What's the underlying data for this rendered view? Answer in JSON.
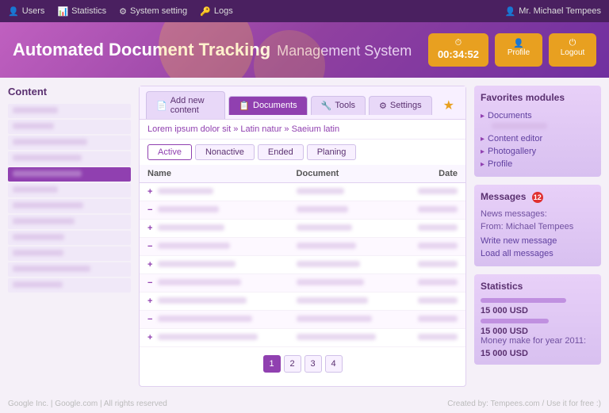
{
  "topnav": {
    "items": [
      {
        "label": "Users",
        "icon": "👤"
      },
      {
        "label": "Statistics",
        "icon": "📊"
      },
      {
        "label": "System setting",
        "icon": "⚙"
      },
      {
        "label": "Logs",
        "icon": "🔑"
      }
    ],
    "user": "Mr. Michael Tempees",
    "user_icon": "👤"
  },
  "header": {
    "title_main": "Automated Document Tracking",
    "title_sub": "Management System",
    "btn_time": "00:34:52",
    "btn_profile": "Profile",
    "btn_logout": "Logout"
  },
  "sidebar": {
    "title": "Content",
    "items": [
      {
        "label": "Lorem ipsum dolor sit",
        "active": false
      },
      {
        "label": "Lorem ipsum dolor sit",
        "active": false
      },
      {
        "label": "Lorem ipsum dolor sit",
        "active": false
      },
      {
        "label": "Lorem ipsum dolor sit",
        "active": false
      },
      {
        "label": "Content ipsum dolor sit",
        "active": true
      },
      {
        "label": "Lorem sit amet",
        "active": false
      },
      {
        "label": "Nec sit amet adipiscing",
        "active": false
      },
      {
        "label": "Nec sit amet adipiscing",
        "active": false
      },
      {
        "label": "Augue ipsum dolor amet",
        "active": false
      },
      {
        "label": "Impsum",
        "active": false
      },
      {
        "label": "Et iaculis per torquent",
        "active": false
      },
      {
        "label": "Et iaculis per torquent",
        "active": false
      }
    ]
  },
  "content": {
    "tabs": [
      {
        "label": "Add new content",
        "icon": "📄",
        "active": false
      },
      {
        "label": "Documents",
        "icon": "📋",
        "active": true
      },
      {
        "label": "Tools",
        "icon": "🔧",
        "active": false
      },
      {
        "label": "Settings",
        "icon": "⚙",
        "active": false
      }
    ],
    "breadcrumb": "Lorem ipsum dolor sit » Latin natur »  Saeium latin",
    "filter_tabs": [
      "Active",
      "Nonactive",
      "Ended",
      "Planing"
    ],
    "active_filter": "Active",
    "table": {
      "headers": [
        "Name",
        "Document",
        "Date"
      ],
      "rows": [
        {
          "prefix": "+",
          "name": "Lorem dolor sit amet",
          "document": "Elit adipiscing",
          "date": "2011-01-01",
          "highlight": false
        },
        {
          "prefix": "−",
          "name": "Lorem dolor sit amet",
          "document": "Elit adipiscing",
          "date": "2011-01-01",
          "highlight": true
        },
        {
          "prefix": "+",
          "name": "Lorem dolor sit amet",
          "document": "Elit adipiscing",
          "date": "2011-01-01",
          "highlight": false
        },
        {
          "prefix": "−",
          "name": "Lorem dolor sit amet",
          "document": "Elit adipiscing",
          "date": "2011-01-01",
          "highlight": false
        },
        {
          "prefix": "+",
          "name": "Lorem dolor sit amet",
          "document": "Elit adipiscing",
          "date": "2011-01-01",
          "highlight": false
        },
        {
          "prefix": "−",
          "name": "Lorem dolor sit amet",
          "document": "Elit-adipiscing",
          "date": "2011-01-01",
          "highlight": false
        },
        {
          "prefix": "+",
          "name": "Lorem dolor sit amet",
          "document": "Elit adipiscing",
          "date": "2011-01-01",
          "highlight": false
        },
        {
          "prefix": "−",
          "name": "Lorem dolor sit amet",
          "document": "Elit adipiscing",
          "date": "2011-01-01",
          "highlight": true
        },
        {
          "prefix": "+",
          "name": "Lorem dolor sit amet",
          "document": "Elit adipiscing",
          "date": "2011-01-01",
          "highlight": false
        }
      ]
    },
    "pagination": [
      "1",
      "2",
      "3",
      "4"
    ],
    "active_page": "1"
  },
  "favorites": {
    "title": "Favorites modules",
    "items": [
      {
        "label": "Documents",
        "sub": "Lorem ipsum"
      },
      {
        "label": "Content editor",
        "sub": null
      },
      {
        "label": "Photogallery",
        "sub": null
      },
      {
        "label": "Profile",
        "sub": null
      }
    ]
  },
  "messages": {
    "title": "Messages",
    "badge": "12",
    "news_label": "News messages:",
    "from_label": "From:",
    "from": "Michael Tempees",
    "write": "Write new message",
    "load": "Load all messages"
  },
  "statistics": {
    "title": "Statistics",
    "bar1_width": "75",
    "value1": "15 000 USD",
    "bar2_width": "60",
    "value2": "15 000 USD",
    "money_label": "Money make for year 2011:",
    "money_value": "15 000 USD"
  },
  "footer": {
    "left": "Google Inc. | Google.com | All rights reserved",
    "right": "Created by: Tempees.com / Use it for free :)"
  }
}
